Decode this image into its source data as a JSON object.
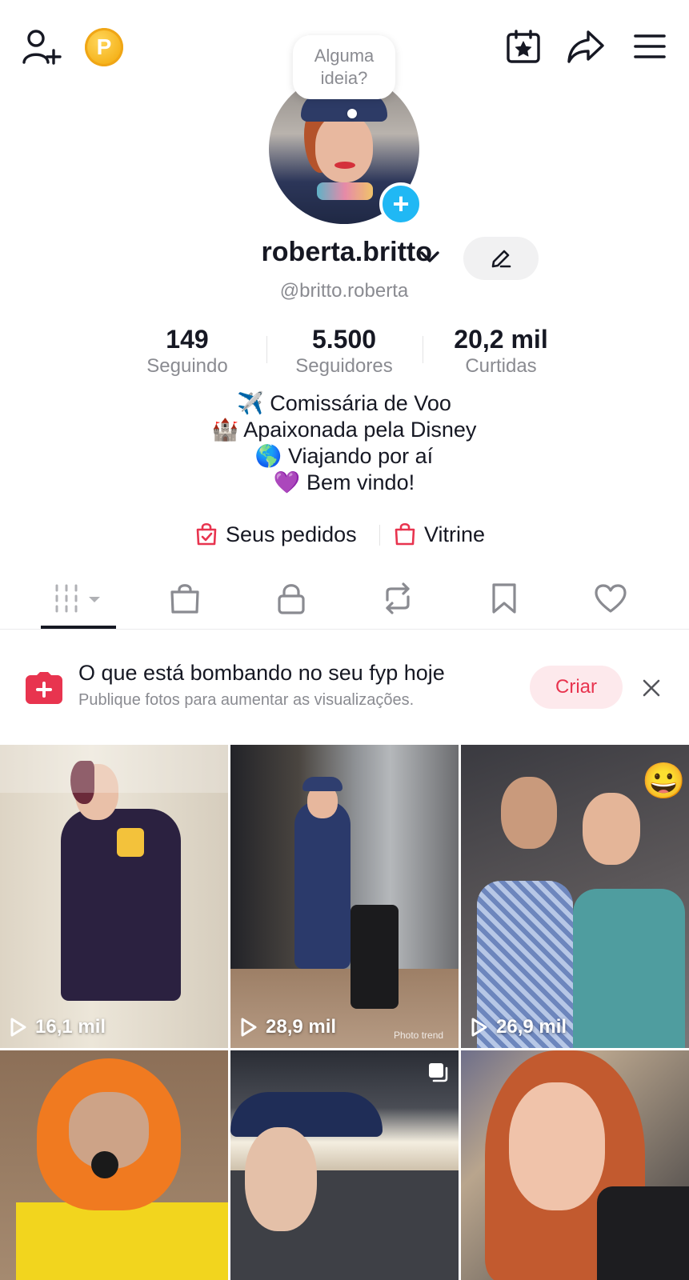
{
  "header": {
    "coin_letter": "P",
    "icons": [
      "add-friend-icon",
      "points-coin-icon",
      "calendar-star-icon",
      "share-icon",
      "menu-icon"
    ]
  },
  "profile": {
    "idea_bubble": [
      "Alguma",
      "ideia?"
    ],
    "display_name": "roberta.britto",
    "username": "@britto.roberta",
    "stats": [
      {
        "value": "149",
        "label": "Seguindo"
      },
      {
        "value": "5.500",
        "label": "Seguidores"
      },
      {
        "value": "20,2 mil",
        "label": "Curtidas"
      }
    ],
    "bio": [
      "✈️ Comissária de Voo",
      "🏰 Apaixonada pela Disney",
      "🌎 Viajando por aí",
      "💜 Bem vindo!"
    ],
    "links": {
      "orders": "Seus pedidos",
      "showcase": "Vitrine"
    }
  },
  "tabs": [
    "videos-grid-tab",
    "shop-tab",
    "private-tab",
    "reposts-tab",
    "saved-tab",
    "liked-tab"
  ],
  "banner": {
    "title": "O que está bombando no seu fyp hoje",
    "subtitle": "Publique fotos para aumentar as visualizações.",
    "cta": "Criar"
  },
  "videos": [
    {
      "views": "16,1 mil"
    },
    {
      "views": "28,9 mil",
      "watermark": "Photo trend"
    },
    {
      "views": "26,9 mil",
      "sticker": "😀"
    },
    {
      "views": ""
    },
    {
      "views": ""
    },
    {
      "views": ""
    }
  ],
  "colors": {
    "accent": "#e8344f",
    "link_icon": "#e8344f",
    "avatar_add": "#20b8f4",
    "text": "#161823",
    "muted": "#8a8b91"
  }
}
